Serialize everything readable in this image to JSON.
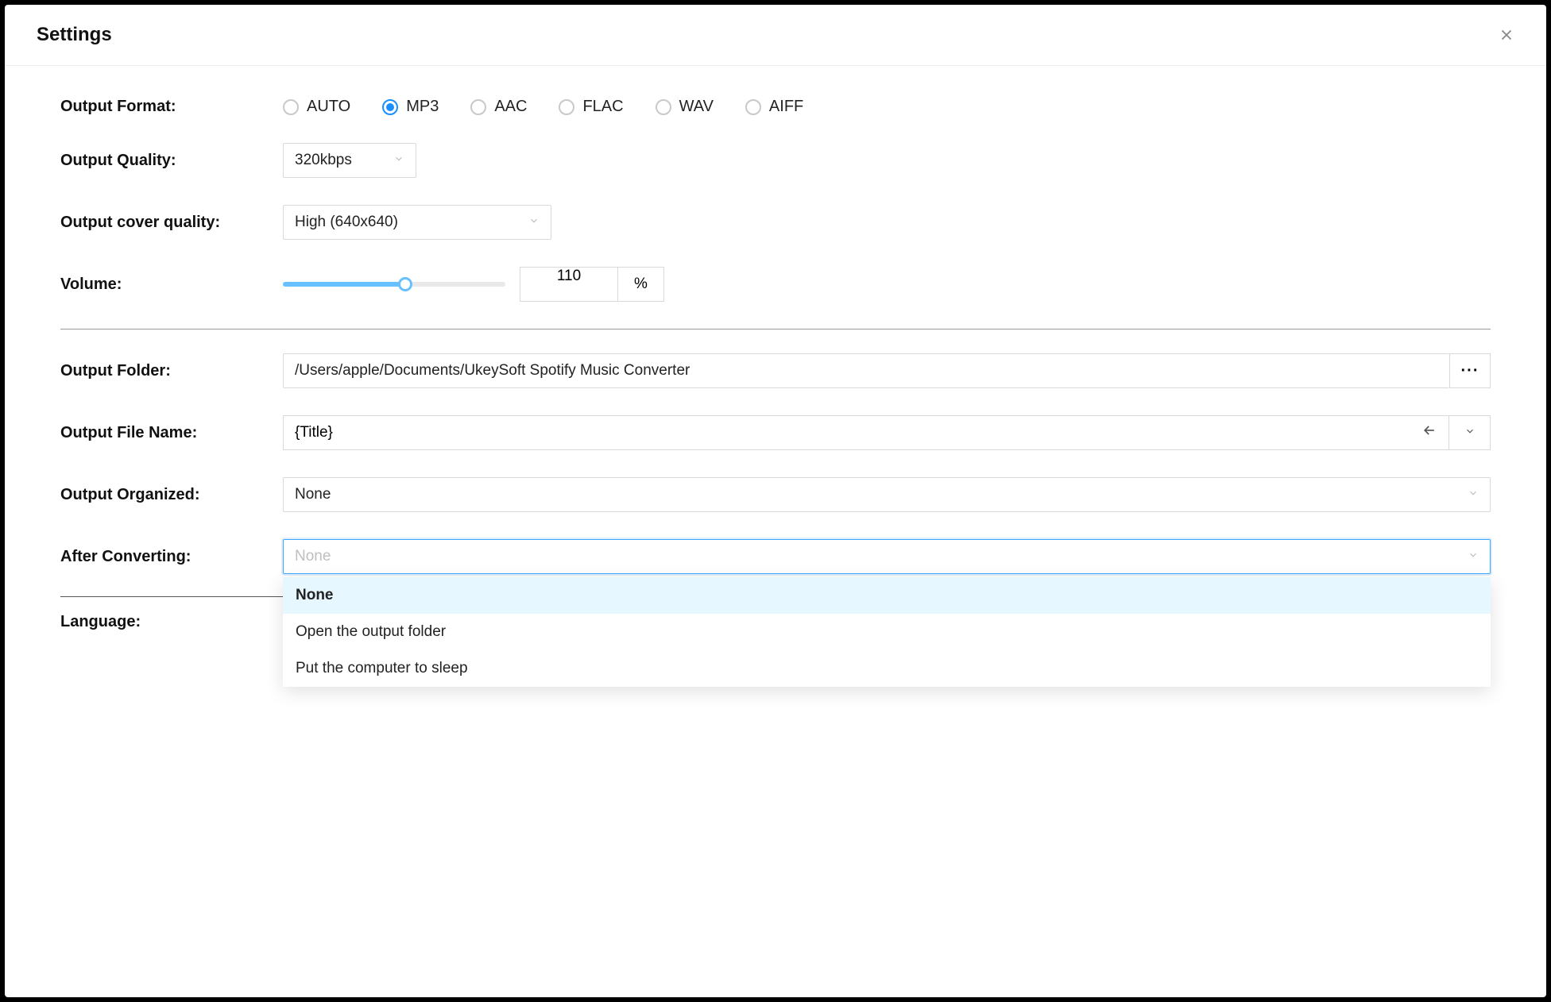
{
  "dialog": {
    "title": "Settings"
  },
  "labels": {
    "output_format": "Output Format:",
    "output_quality": "Output Quality:",
    "output_cover_quality": "Output cover quality:",
    "volume": "Volume:",
    "output_folder": "Output Folder:",
    "output_file_name": "Output File Name:",
    "output_organized": "Output Organized:",
    "after_converting": "After Converting:",
    "language": "Language:"
  },
  "output_format": {
    "options": [
      "AUTO",
      "MP3",
      "AAC",
      "FLAC",
      "WAV",
      "AIFF"
    ],
    "selected": "MP3"
  },
  "output_quality": {
    "value": "320kbps"
  },
  "output_cover_quality": {
    "value": "High (640x640)"
  },
  "volume": {
    "value": "110",
    "unit": "%",
    "percent": 55
  },
  "output_folder": {
    "value": "/Users/apple/Documents/UkeySoft Spotify Music Converter"
  },
  "output_file_name": {
    "value": "{Title}"
  },
  "output_organized": {
    "value": "None"
  },
  "after_converting": {
    "value": "None",
    "options": [
      "None",
      "Open the output folder",
      "Put the computer to sleep"
    ],
    "selected_index": 0
  },
  "icons": {
    "ellipsis": "···"
  }
}
